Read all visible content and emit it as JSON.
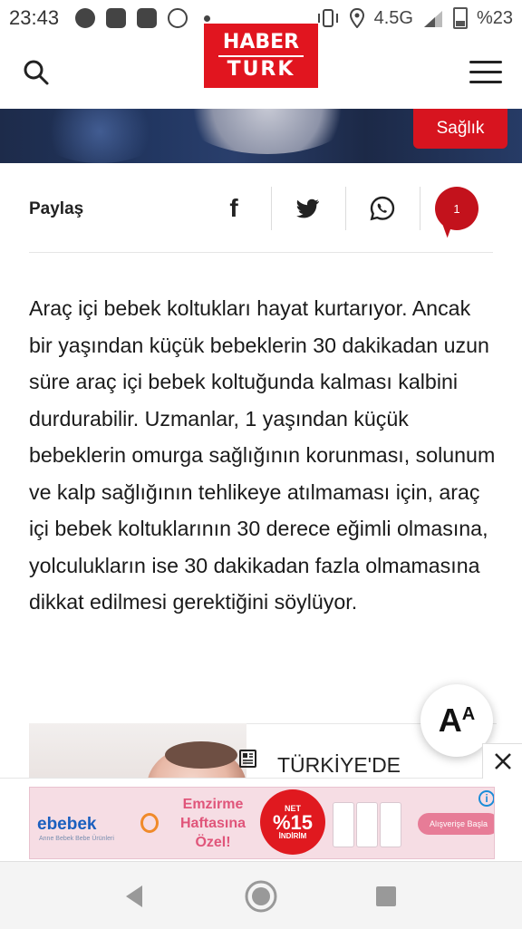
{
  "status_bar": {
    "time": "23:43",
    "network": "4.5G",
    "battery": "%23",
    "icons": [
      "facebook-icon",
      "photo-app-icon",
      "snowflake-app-icon",
      "voice-app-icon",
      "notification-dot-icon",
      "vibrate-icon",
      "location-icon",
      "signal-icon",
      "battery-icon"
    ]
  },
  "header": {
    "logo_line1": "HABER",
    "logo_line2": "TURK",
    "brand_color": "#e1151f"
  },
  "hero": {
    "category": "Sağlık"
  },
  "share": {
    "label": "Paylaş",
    "facebook_glyph": "f",
    "comment_count": "1"
  },
  "article": {
    "paragraph": "Araç içi bebek koltukları hayat kurtarıyor. Ancak bir yaşından küçük bebeklerin 30 dakikadan uzun süre araç içi bebek koltuğunda kalması kalbini durdurabilir. Uzmanlar, 1 yaşından küçük bebeklerin omurga sağlığının korunması, solunum ve kalp sağlığının tehlikeye atılmaması için, araç içi bebek koltuklarının 30 derece eğimli olmasına, yolculukların ise 30 dakikadan fazla olmamasına dikkat edilmesi gerektiğini söylüyor."
  },
  "related": {
    "title": "TÜRKİYE'DE"
  },
  "font_button": {
    "big": "A",
    "small": "A"
  },
  "ad": {
    "brand": "ebebek",
    "brand_sub": "Anne Bebek Bebe Ürünleri",
    "slogan_line1": "Emzirme",
    "slogan_line2": "Haftasına",
    "slogan_line3": "Özel!",
    "discount_top": "NET",
    "discount_value": "%15",
    "discount_bottom": "İNDİRİM",
    "cta": "Alışverişe Başla",
    "info_glyph": "i",
    "close_glyph": "X"
  },
  "nav": {
    "back": "back-icon",
    "home": "home-icon",
    "recents": "recents-icon"
  }
}
